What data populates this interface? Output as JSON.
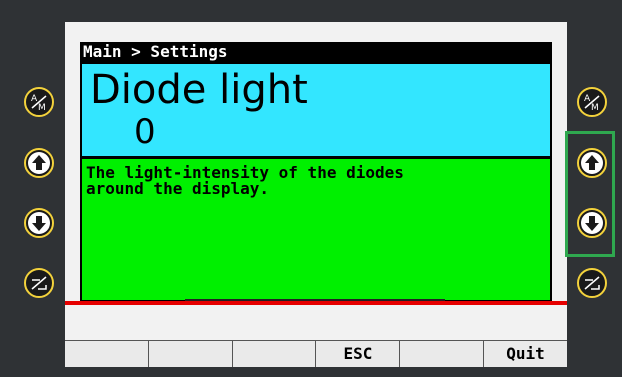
{
  "breadcrumb": "Main > Settings",
  "setting": {
    "title": "Diode light",
    "value": "0",
    "description": "The light-intensity of the diodes\naround the display."
  },
  "softkeys": [
    "",
    "",
    "",
    "ESC",
    "",
    "Quit"
  ],
  "side_buttons": {
    "left": [
      "auto-manual-icon",
      "arrow-up-icon",
      "arrow-down-icon",
      "hand-icon"
    ],
    "right": [
      "auto-manual-icon",
      "arrow-up-icon",
      "arrow-down-icon",
      "hand-icon"
    ]
  },
  "colors": {
    "title_bg": "#33e6ff",
    "desc_bg": "#00f000",
    "button_ring": "#f3d23c",
    "highlight": "#2fa84f",
    "separator": "#e60000"
  }
}
